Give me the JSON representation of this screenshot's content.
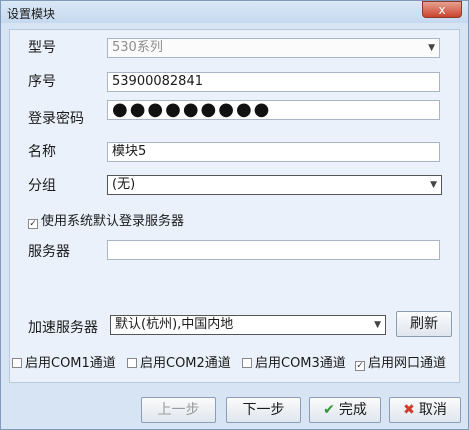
{
  "window": {
    "title": "设置模块",
    "close_glyph": "x"
  },
  "form": {
    "model_label": "型号",
    "model_value": "530系列",
    "serial_label": "序号",
    "serial_value": "53900082841",
    "password_label": "登录密码",
    "password_value": "●●●●●●●●●",
    "name_label": "名称",
    "name_value": "模块5",
    "group_label": "分组",
    "group_value": "(无)",
    "use_default_server": "使用系统默认登录服务器",
    "server_label": "服务器",
    "server_value": "",
    "accel_label": "加速服务器",
    "accel_value": "默认(杭州),中国内地",
    "refresh_button": "刷新"
  },
  "channels": [
    {
      "label": "启用COM1通道",
      "checked": false
    },
    {
      "label": "启用COM2通道",
      "checked": false
    },
    {
      "label": "启用COM3通道",
      "checked": false
    },
    {
      "label": "启用网口通道",
      "checked": true
    }
  ],
  "buttons": {
    "prev": "上一步",
    "next": "下一步",
    "finish": "完成",
    "cancel": "取消"
  }
}
